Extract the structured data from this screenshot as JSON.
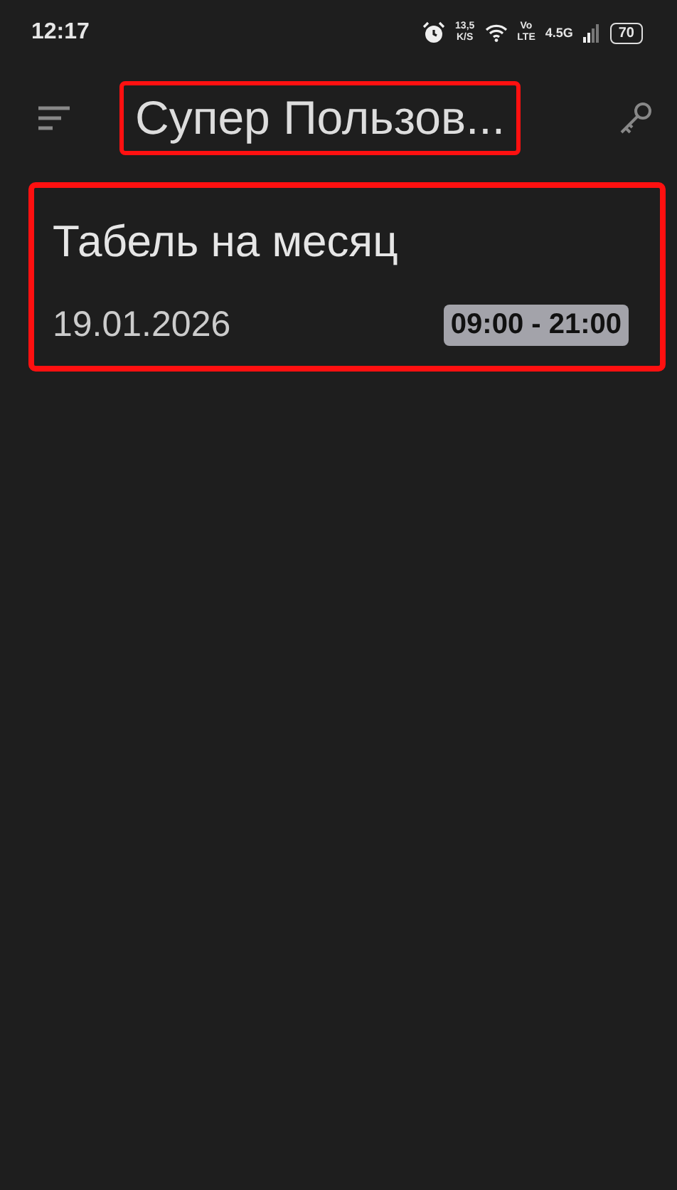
{
  "status_bar": {
    "time": "12:17",
    "speed": "13,5",
    "speed_unit": "K/S",
    "volte_top": "Vo",
    "volte_bottom": "LTE",
    "network": "4.5G",
    "battery": "70"
  },
  "app_bar": {
    "title": "Супер Пользов..."
  },
  "cards": [
    {
      "title": "Табель на месяц",
      "date": "19.01.2026",
      "hours": "09:00 - 21:00"
    }
  ]
}
